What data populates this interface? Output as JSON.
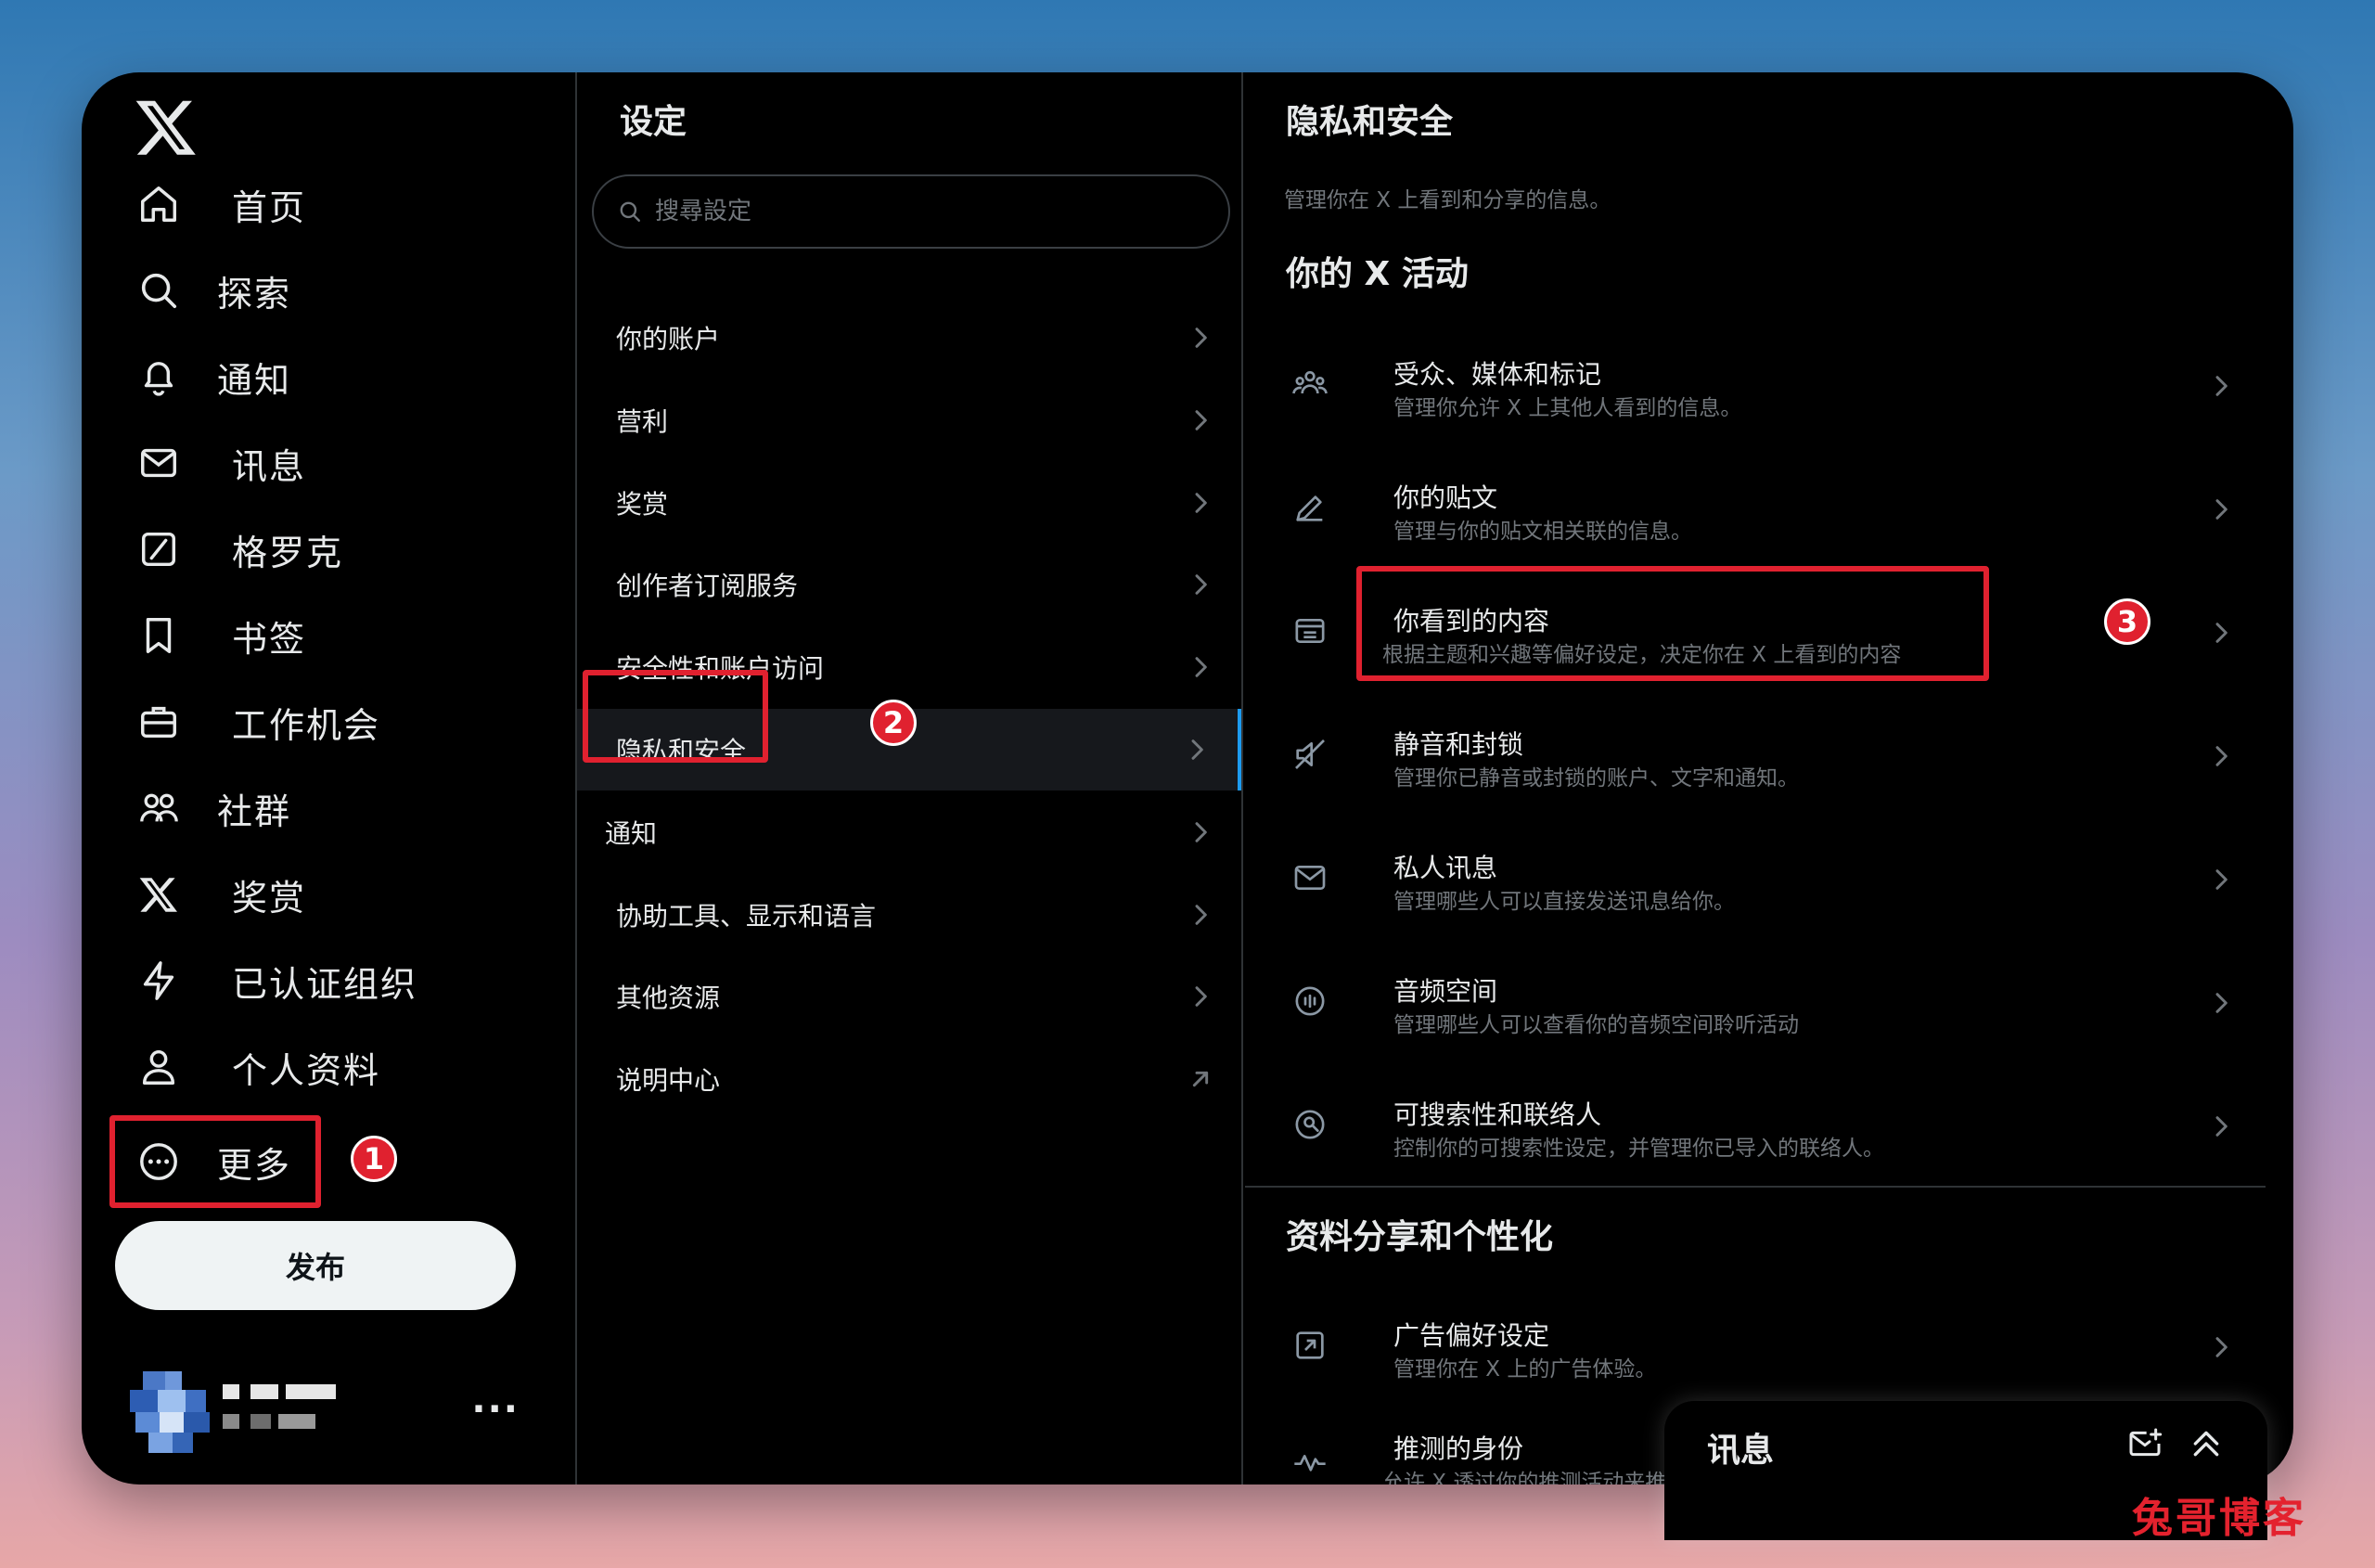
{
  "nav": {
    "items": [
      {
        "label": "首页",
        "icon": "home-icon"
      },
      {
        "label": "探索",
        "icon": "search-icon"
      },
      {
        "label": "通知",
        "icon": "bell-icon"
      },
      {
        "label": "讯息",
        "icon": "mail-icon"
      },
      {
        "label": "格罗克",
        "icon": "grok-icon"
      },
      {
        "label": "书签",
        "icon": "bookmark-icon"
      },
      {
        "label": "工作机会",
        "icon": "briefcase-icon"
      },
      {
        "label": "社群",
        "icon": "communities-icon"
      },
      {
        "label": "奖赏",
        "icon": "x-premium-icon"
      },
      {
        "label": "已认证组织",
        "icon": "lightning-icon"
      },
      {
        "label": "个人资料",
        "icon": "person-icon"
      },
      {
        "label": "更多",
        "icon": "more-circle-icon"
      }
    ],
    "post_button": "发布",
    "user_more": "···"
  },
  "settings": {
    "title": "设定",
    "search_placeholder": "搜尋設定",
    "items": [
      {
        "label": "你的账户",
        "arrow": "chevron"
      },
      {
        "label": "营利",
        "arrow": "chevron"
      },
      {
        "label": "奖赏",
        "arrow": "chevron"
      },
      {
        "label": "创作者订阅服务",
        "arrow": "chevron"
      },
      {
        "label": "安全性和账户访问",
        "arrow": "chevron"
      },
      {
        "label": "隐私和安全",
        "arrow": "chevron",
        "active": true
      },
      {
        "label": "通知",
        "arrow": "chevron"
      },
      {
        "label": "协助工具、显示和语言",
        "arrow": "chevron"
      },
      {
        "label": "其他资源",
        "arrow": "chevron"
      },
      {
        "label": "说明中心",
        "arrow": "external"
      }
    ]
  },
  "privacy": {
    "title": "隐私和安全",
    "subtitle": "管理你在 X 上看到和分享的信息。",
    "section1": "你的 X 活动",
    "items": [
      {
        "title": "受众、媒体和标记",
        "desc": "管理你允许 X 上其他人看到的信息。",
        "icon": "audience-icon"
      },
      {
        "title": "你的贴文",
        "desc": "管理与你的贴文相关联的信息。",
        "icon": "pencil-icon"
      },
      {
        "title": "你看到的内容",
        "desc": "根据主题和兴趣等偏好设定，决定你在 X 上看到的内容",
        "icon": "content-icon"
      },
      {
        "title": "静音和封锁",
        "desc": "管理你已静音或封锁的账户、文字和通知。",
        "icon": "mute-icon"
      },
      {
        "title": "私人讯息",
        "desc": "管理哪些人可以直接发送讯息给你。",
        "icon": "envelope-icon"
      },
      {
        "title": "音频空间",
        "desc": "管理哪些人可以查看你的音频空间聆听活动",
        "icon": "spaces-icon"
      },
      {
        "title": "可搜索性和联络人",
        "desc": "控制你的可搜索性设定，并管理你已导入的联络人。",
        "icon": "discover-icon"
      }
    ],
    "section2": "资料分享和个性化",
    "items2": [
      {
        "title": "广告偏好设定",
        "desc": "管理你在 X 上的广告体验。",
        "icon": "ads-icon"
      },
      {
        "title": "推测的身份",
        "desc": "允许 X 透过你的推测活动来推",
        "icon": "activity-icon"
      }
    ]
  },
  "drawer": {
    "title": "讯息"
  },
  "annotations": {
    "badge1": "1",
    "badge2": "2",
    "badge3": "3"
  },
  "watermark": "兔哥博客",
  "colors": {
    "highlight": "#e0212f",
    "accent": "#1d9bf0",
    "background": "#000000"
  }
}
